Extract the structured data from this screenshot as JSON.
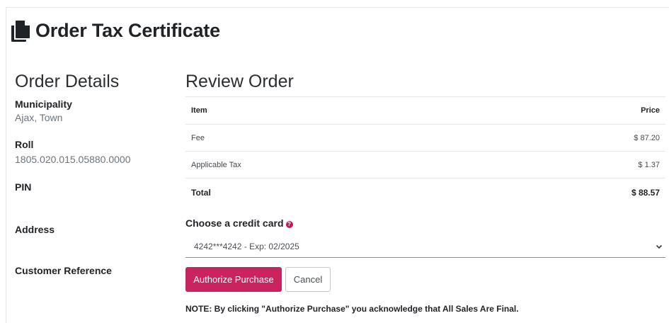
{
  "page": {
    "title": "Order Tax Certificate",
    "icon": "copy-documents-icon"
  },
  "order_details": {
    "heading": "Order Details",
    "fields": [
      {
        "label": "Municipality",
        "value": "Ajax, Town"
      },
      {
        "label": "Roll",
        "value": "1805.020.015.05880.0000"
      },
      {
        "label": "PIN",
        "value": ""
      },
      {
        "label": "Address",
        "value": ""
      },
      {
        "label": "Customer Reference",
        "value": ""
      }
    ]
  },
  "review_order": {
    "heading": "Review Order",
    "columns": {
      "item": "Item",
      "price": "Price"
    },
    "rows": [
      {
        "item": "Fee",
        "price": "$ 87.20"
      },
      {
        "item": "Applicable Tax",
        "price": "$ 1.37"
      }
    ],
    "total": {
      "label": "Total",
      "price": "$ 88.57"
    }
  },
  "payment": {
    "label": "Choose a credit card",
    "help_icon": "question-circle-icon",
    "selected_card": "4242***4242 - Exp: 02/2025"
  },
  "actions": {
    "authorize_label": "Authorize Purchase",
    "cancel_label": "Cancel"
  },
  "note": "NOTE: By clicking \"Authorize Purchase\" you acknowledge that All Sales Are Final.",
  "colors": {
    "accent": "#c9245f",
    "text": "#212529",
    "muted": "#6c757d"
  }
}
